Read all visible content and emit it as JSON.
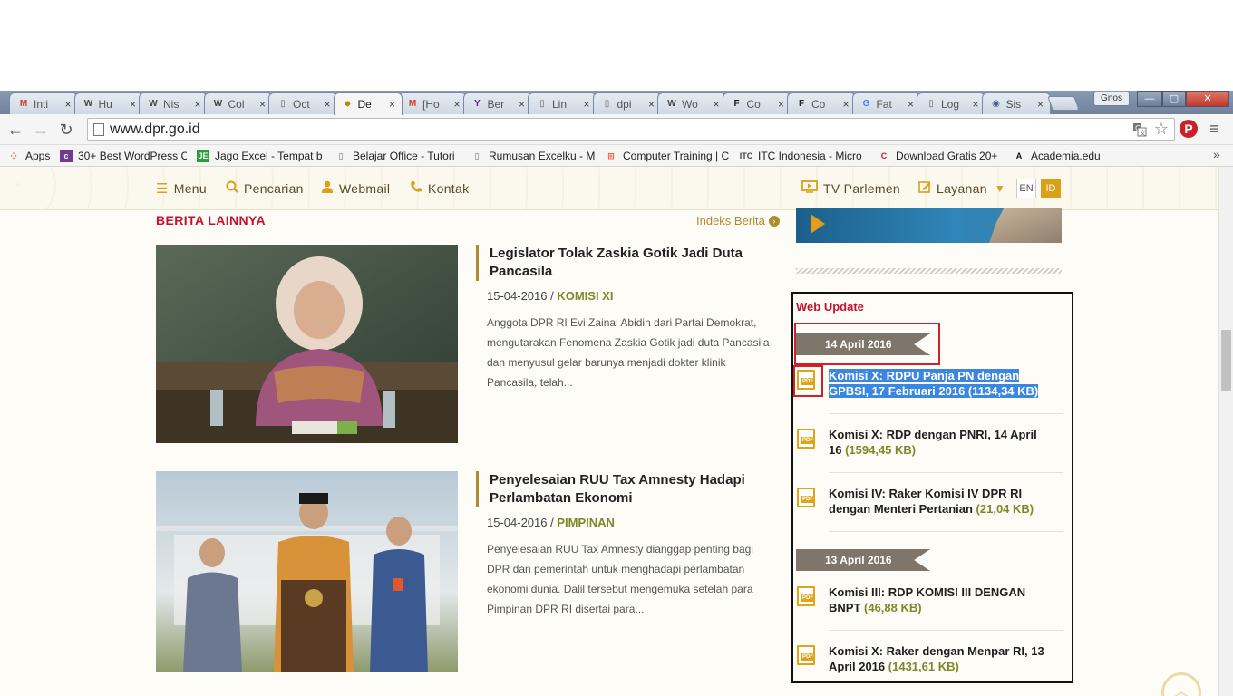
{
  "browser": {
    "tabs": [
      {
        "icon": "gmail",
        "label": "Inti"
      },
      {
        "icon": "wordpress",
        "label": "Hu"
      },
      {
        "icon": "wordpress",
        "label": "Nis"
      },
      {
        "icon": "wordpress",
        "label": "Col"
      },
      {
        "icon": "page",
        "label": "Oct"
      },
      {
        "icon": "dpr-emblem",
        "label": "De",
        "active": true
      },
      {
        "icon": "gmail",
        "label": "[Ho"
      },
      {
        "icon": "yahoo",
        "label": "Ber"
      },
      {
        "icon": "page",
        "label": "Lin"
      },
      {
        "icon": "page",
        "label": "dpi"
      },
      {
        "icon": "wordpress",
        "label": "Wo"
      },
      {
        "icon": "f-logo",
        "label": "Co"
      },
      {
        "icon": "f-logo",
        "label": "Co"
      },
      {
        "icon": "google",
        "label": "Fat"
      },
      {
        "icon": "page",
        "label": "Log"
      },
      {
        "icon": "globe",
        "label": "Sis"
      }
    ],
    "tab_close": "×",
    "window_user": "Gnos",
    "window_controls": {
      "minimize": "—",
      "maximize": "▢",
      "close": "✕"
    },
    "nav": {
      "back": "←",
      "forward": "→",
      "reload": "↻"
    },
    "url": "www.dpr.go.id",
    "menu_icon": "≡",
    "pinterest": "P",
    "bookmarks": [
      {
        "icon": "apps-grid",
        "label": "Apps"
      },
      {
        "icon": "colorlib",
        "label": "30+ Best WordPress C"
      },
      {
        "icon": "je",
        "label": "Jago Excel - Tempat b"
      },
      {
        "icon": "page",
        "label": "Belajar Office - Tutori"
      },
      {
        "icon": "page",
        "label": "Rumusan Excelku - M"
      },
      {
        "icon": "windows",
        "label": "Computer Training | C"
      },
      {
        "icon": "itc",
        "label": "ITC Indonesia - Micro"
      },
      {
        "icon": "c-logo",
        "label": "Download Gratis 20+"
      },
      {
        "icon": "a-logo",
        "label": "Academia.edu"
      }
    ],
    "bookmarks_more": "»"
  },
  "site_nav": {
    "menu": "Menu",
    "search": "Pencarian",
    "webmail": "Webmail",
    "contact": "Kontak",
    "tv": "TV Parlemen",
    "services": "Layanan",
    "lang_en": "EN",
    "lang_id": "ID"
  },
  "news": {
    "heading": "BERITA LAINNYA",
    "index_link": "Indeks Berita",
    "items": [
      {
        "title": "Legislator Tolak Zaskia Gotik Jadi Duta Pancasila",
        "date": "15-04-2016",
        "category": "KOMISI XI",
        "excerpt": "Anggota DPR RI Evi Zainal Abidin dari Partai Demokrat, mengutarakan Fenomena Zaskia Gotik jadi duta Pancasila dan menyusul gelar barunya menjadi dokter klinik Pancasila, telah..."
      },
      {
        "title": "Penyelesaian RUU Tax Amnesty Hadapi Perlambatan Ekonomi",
        "date": "15-04-2016",
        "category": "PIMPINAN",
        "excerpt": "Penyelesaian RUU Tax Amnesty dianggap penting bagi DPR dan pemerintah untuk menghadapi perlambatan ekonomi dunia. Dalil tersebut mengemuka setelah para Pimpinan DPR RI disertai para..."
      }
    ],
    "meta_sep": " / "
  },
  "web_update": {
    "title": "Web Update",
    "groups": [
      {
        "date": "14 April 2016",
        "docs": [
          {
            "text": "Komisi X: RDPU Panja PN dengan GPBSI, 17 Februari 2016",
            "size": "(1134,34 KB)",
            "selected": true
          },
          {
            "text": "Komisi X: RDP dengan PNRI, 14 April 16",
            "size": "(1594,45 KB)"
          },
          {
            "text": "Komisi IV: Raker Komisi IV DPR RI dengan Menteri Pertanian",
            "size": "(21,04 KB)"
          }
        ]
      },
      {
        "date": "13 April 2016",
        "docs": [
          {
            "text": "Komisi III: RDP KOMISI III DENGAN BNPT",
            "size": "(46,88 KB)"
          },
          {
            "text": "Komisi X: Raker dengan Menpar RI, 13 April 2016",
            "size": "(1431,61 KB)"
          }
        ]
      }
    ],
    "pdf_tag": "PDF"
  },
  "scroll_top_icon": "chevron-up-icon",
  "colors": {
    "accent_red": "#c8102e",
    "gold": "#d9a01a",
    "category_green": "#7a8a2a",
    "ribbon": "#7e766a",
    "selection": "#3b86e0"
  }
}
